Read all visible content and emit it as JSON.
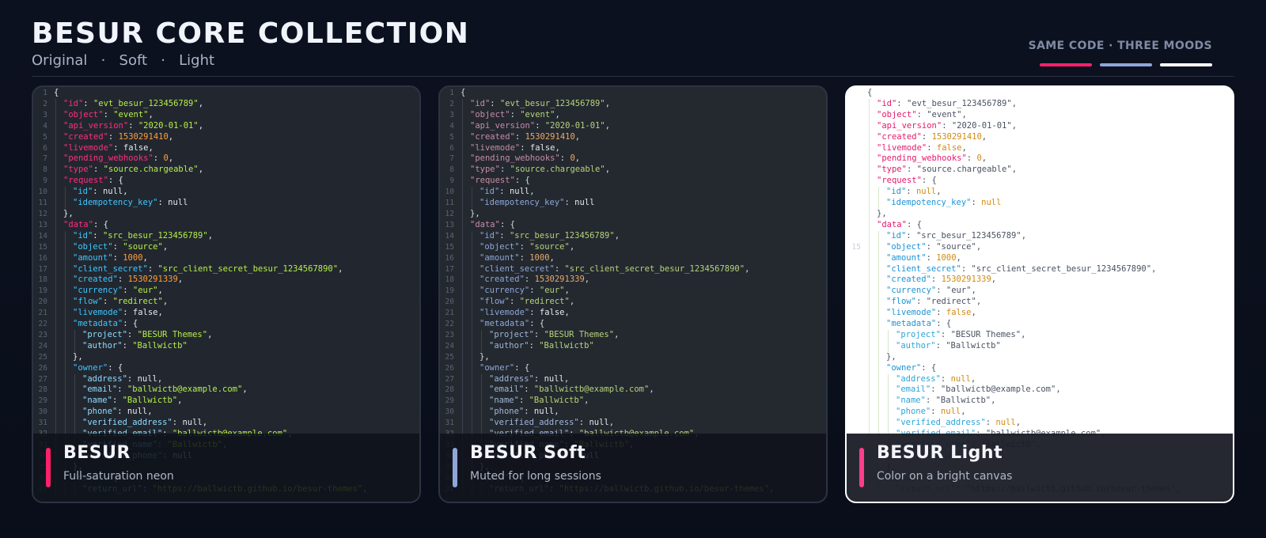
{
  "header": {
    "title": "BESUR CORE COLLECTION",
    "variants": [
      "Original",
      "Soft",
      "Light"
    ],
    "separator": "·",
    "tagline": "SAME CODE · THREE MOODS"
  },
  "swatch_colors": [
    "#ff1f6b",
    "#8fa6d9",
    "#ffffff"
  ],
  "cards": [
    {
      "id": "dark",
      "title": "BESUR",
      "description": "Full-saturation neon",
      "accent": "#ff1f6b"
    },
    {
      "id": "soft",
      "title": "BESUR Soft",
      "description": "Muted for long sessions",
      "accent": "#8fa6d9"
    },
    {
      "id": "light",
      "title": "BESUR Light",
      "description": "Color on a bright canvas",
      "accent": "#ff3d8b"
    }
  ],
  "code_lines": [
    [
      [
        "p",
        "{"
      ]
    ],
    [
      [
        "i",
        1
      ],
      [
        "k",
        "\"id\""
      ],
      [
        "p",
        ": "
      ],
      [
        "s",
        "\"evt_besur_123456789\""
      ],
      [
        "p",
        ","
      ]
    ],
    [
      [
        "i",
        1
      ],
      [
        "k",
        "\"object\""
      ],
      [
        "p",
        ": "
      ],
      [
        "s",
        "\"event\""
      ],
      [
        "p",
        ","
      ]
    ],
    [
      [
        "i",
        1
      ],
      [
        "k",
        "\"api_version\""
      ],
      [
        "p",
        ": "
      ],
      [
        "s",
        "\"2020-01-01\""
      ],
      [
        "p",
        ","
      ]
    ],
    [
      [
        "i",
        1
      ],
      [
        "k",
        "\"created\""
      ],
      [
        "p",
        ": "
      ],
      [
        "n",
        "1530291410"
      ],
      [
        "p",
        ","
      ]
    ],
    [
      [
        "i",
        1
      ],
      [
        "k",
        "\"livemode\""
      ],
      [
        "p",
        ": "
      ],
      [
        "kw",
        "false"
      ],
      [
        "p",
        ","
      ]
    ],
    [
      [
        "i",
        1
      ],
      [
        "k",
        "\"pending_webhooks\""
      ],
      [
        "p",
        ": "
      ],
      [
        "n",
        "0"
      ],
      [
        "p",
        ","
      ]
    ],
    [
      [
        "i",
        1
      ],
      [
        "k",
        "\"type\""
      ],
      [
        "p",
        ": "
      ],
      [
        "s",
        "\"source.chargeable\""
      ],
      [
        "p",
        ","
      ]
    ],
    [
      [
        "i",
        1
      ],
      [
        "k",
        "\"request\""
      ],
      [
        "p",
        ": {"
      ]
    ],
    [
      [
        "i",
        2
      ],
      [
        "k2",
        "\"id\""
      ],
      [
        "p",
        ": "
      ],
      [
        "kw",
        "null"
      ],
      [
        "p",
        ","
      ]
    ],
    [
      [
        "i",
        2
      ],
      [
        "k2",
        "\"idempotency_key\""
      ],
      [
        "p",
        ": "
      ],
      [
        "kw",
        "null"
      ]
    ],
    [
      [
        "i",
        1
      ],
      [
        "p",
        "},"
      ]
    ],
    [
      [
        "i",
        1
      ],
      [
        "k",
        "\"data\""
      ],
      [
        "p",
        ": {"
      ]
    ],
    [
      [
        "i",
        2
      ],
      [
        "k2",
        "\"id\""
      ],
      [
        "p",
        ": "
      ],
      [
        "s",
        "\"src_besur_123456789\""
      ],
      [
        "p",
        ","
      ]
    ],
    [
      [
        "i",
        2
      ],
      [
        "k2",
        "\"object\""
      ],
      [
        "p",
        ": "
      ],
      [
        "s",
        "\"source\""
      ],
      [
        "p",
        ","
      ]
    ],
    [
      [
        "i",
        2
      ],
      [
        "k2",
        "\"amount\""
      ],
      [
        "p",
        ": "
      ],
      [
        "n",
        "1000"
      ],
      [
        "p",
        ","
      ]
    ],
    [
      [
        "i",
        2
      ],
      [
        "k2",
        "\"client_secret\""
      ],
      [
        "p",
        ": "
      ],
      [
        "s",
        "\"src_client_secret_besur_1234567890\""
      ],
      [
        "p",
        ","
      ]
    ],
    [
      [
        "i",
        2
      ],
      [
        "k2",
        "\"created\""
      ],
      [
        "p",
        ": "
      ],
      [
        "n",
        "1530291339"
      ],
      [
        "p",
        ","
      ]
    ],
    [
      [
        "i",
        2
      ],
      [
        "k2",
        "\"currency\""
      ],
      [
        "p",
        ": "
      ],
      [
        "s",
        "\"eur\""
      ],
      [
        "p",
        ","
      ]
    ],
    [
      [
        "i",
        2
      ],
      [
        "k2",
        "\"flow\""
      ],
      [
        "p",
        ": "
      ],
      [
        "s",
        "\"redirect\""
      ],
      [
        "p",
        ","
      ]
    ],
    [
      [
        "i",
        2
      ],
      [
        "k2",
        "\"livemode\""
      ],
      [
        "p",
        ": "
      ],
      [
        "kw",
        "false"
      ],
      [
        "p",
        ","
      ]
    ],
    [
      [
        "i",
        2
      ],
      [
        "k2",
        "\"metadata\""
      ],
      [
        "p",
        ": {"
      ]
    ],
    [
      [
        "i",
        3
      ],
      [
        "k3",
        "\"project\""
      ],
      [
        "p",
        ": "
      ],
      [
        "s",
        "\"BESUR Themes\""
      ],
      [
        "p",
        ","
      ]
    ],
    [
      [
        "i",
        3
      ],
      [
        "k3",
        "\"author\""
      ],
      [
        "p",
        ": "
      ],
      [
        "s",
        "\"Ballwictb\""
      ]
    ],
    [
      [
        "i",
        2
      ],
      [
        "p",
        "},"
      ]
    ],
    [
      [
        "i",
        2
      ],
      [
        "k2",
        "\"owner\""
      ],
      [
        "p",
        ": {"
      ]
    ],
    [
      [
        "i",
        3
      ],
      [
        "k3",
        "\"address\""
      ],
      [
        "p",
        ": "
      ],
      [
        "kw",
        "null"
      ],
      [
        "p",
        ","
      ]
    ],
    [
      [
        "i",
        3
      ],
      [
        "k3",
        "\"email\""
      ],
      [
        "p",
        ": "
      ],
      [
        "s",
        "\"ballwictb@example.com\""
      ],
      [
        "p",
        ","
      ]
    ],
    [
      [
        "i",
        3
      ],
      [
        "k3",
        "\"name\""
      ],
      [
        "p",
        ": "
      ],
      [
        "s",
        "\"Ballwictb\""
      ],
      [
        "p",
        ","
      ]
    ],
    [
      [
        "i",
        3
      ],
      [
        "k3",
        "\"phone\""
      ],
      [
        "p",
        ": "
      ],
      [
        "kw",
        "null"
      ],
      [
        "p",
        ","
      ]
    ],
    [
      [
        "i",
        3
      ],
      [
        "k3",
        "\"verified_address\""
      ],
      [
        "p",
        ": "
      ],
      [
        "kw",
        "null"
      ],
      [
        "p",
        ","
      ]
    ],
    [
      [
        "i",
        3
      ],
      [
        "k3",
        "\"verified_email\""
      ],
      [
        "p",
        ": "
      ],
      [
        "s",
        "\"ballwictb@example.com\""
      ],
      [
        "p",
        ","
      ]
    ],
    [
      [
        "i",
        3
      ],
      [
        "k3",
        "\"verified_name\""
      ],
      [
        "p",
        ": "
      ],
      [
        "s",
        "\"Ballwictb\""
      ],
      [
        "p",
        ","
      ]
    ],
    [
      [
        "i",
        3
      ],
      [
        "k3",
        "\"verified_phone\""
      ],
      [
        "p",
        ": "
      ],
      [
        "kw",
        "null"
      ]
    ],
    [
      [
        "i",
        2
      ],
      [
        "p",
        "},"
      ]
    ],
    [
      [
        "i",
        2
      ],
      [
        "k2",
        "\"data\""
      ],
      [
        "p",
        ": {"
      ]
    ],
    [
      [
        "i",
        3
      ],
      [
        "k3",
        "\"return_url\""
      ],
      [
        "p",
        ": "
      ],
      [
        "s",
        "\"https://ballwictb.github.io/besur-themes\""
      ],
      [
        "p",
        ","
      ]
    ]
  ]
}
